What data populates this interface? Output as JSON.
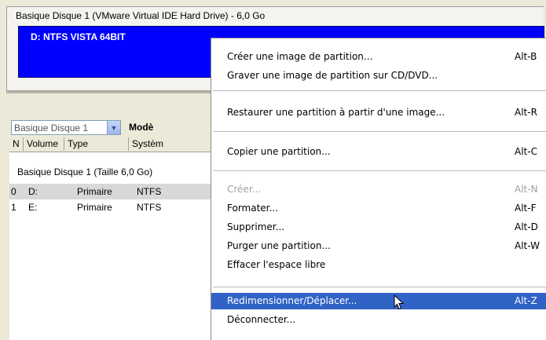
{
  "disk_map": {
    "title": "Basique Disque 1 (VMware Virtual IDE Hard Drive) - 6,0 Go",
    "partition_label": "D: NTFS VISTA 64BIT",
    "partition_color": "#0000ff"
  },
  "toolbar": {
    "disk_select_value": "Basique Disque 1",
    "model_label": "Modè"
  },
  "table": {
    "headers": [
      "N",
      "Volume",
      "Type",
      "Systèm"
    ],
    "group_label": "Basique Disque 1 (Taille 6,0 Go)",
    "rows": [
      {
        "n": "0",
        "volume": "D:",
        "type": "Primaire",
        "fs": "NTFS"
      },
      {
        "n": "1",
        "volume": "E:",
        "type": "Primaire",
        "fs": "NTFS"
      }
    ]
  },
  "context_menu": {
    "items": [
      {
        "label": "Créer une image de partition...",
        "shortcut": "Alt-B",
        "enabled": true,
        "highlighted": false
      },
      {
        "label": "Graver une image de partition sur CD/DVD...",
        "shortcut": "",
        "enabled": true,
        "highlighted": false
      },
      {
        "label": "Restaurer une partition à partir d'une image...",
        "shortcut": "Alt-R",
        "enabled": true,
        "highlighted": false
      },
      {
        "label": "Copier une partition...",
        "shortcut": "Alt-C",
        "enabled": true,
        "highlighted": false
      },
      {
        "label": "Créer...",
        "shortcut": "Alt-N",
        "enabled": false,
        "highlighted": false
      },
      {
        "label": "Formater...",
        "shortcut": "Alt-F",
        "enabled": true,
        "highlighted": false
      },
      {
        "label": "Supprimer...",
        "shortcut": "Alt-D",
        "enabled": true,
        "highlighted": false
      },
      {
        "label": "Purger une partition...",
        "shortcut": "Alt-W",
        "enabled": true,
        "highlighted": false
      },
      {
        "label": "Effacer l'espace libre",
        "shortcut": "",
        "enabled": true,
        "highlighted": false
      },
      {
        "label": "Redimensionner/Déplacer...",
        "shortcut": "Alt-Z",
        "enabled": true,
        "highlighted": true
      },
      {
        "label": "Déconnecter...",
        "shortcut": "",
        "enabled": true,
        "highlighted": false
      }
    ],
    "highlight_color": "#3163c6"
  }
}
